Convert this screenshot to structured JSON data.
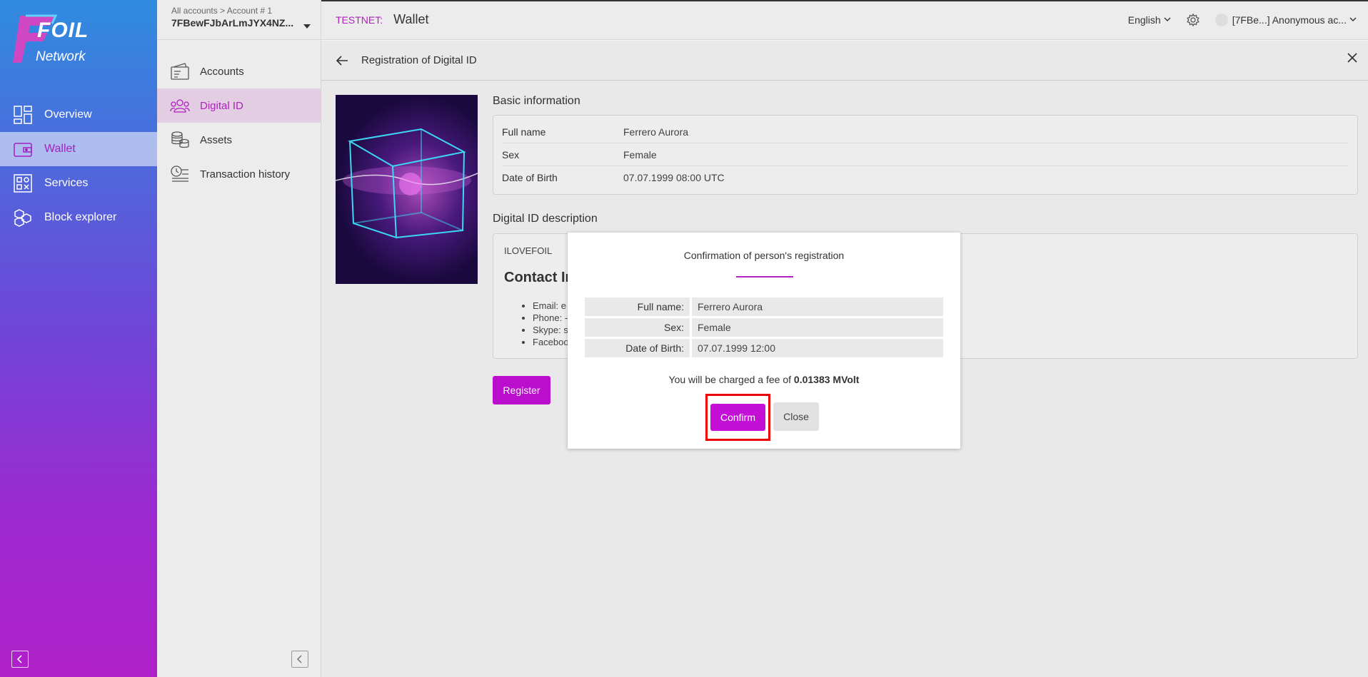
{
  "brand": {
    "name_line1": "FOIL",
    "name_line2": "Network"
  },
  "main_nav": [
    {
      "label": "Overview",
      "icon": "overview-icon",
      "active": false
    },
    {
      "label": "Wallet",
      "icon": "wallet-icon",
      "active": true
    },
    {
      "label": "Services",
      "icon": "services-icon",
      "active": false
    },
    {
      "label": "Block explorer",
      "icon": "block-explorer-icon",
      "active": false
    }
  ],
  "account": {
    "breadcrumb": "All accounts > Account # 1",
    "id": "7FBewFJbArLmJYX4NZ..."
  },
  "sub_nav": [
    {
      "label": "Accounts",
      "icon": "accounts-icon"
    },
    {
      "label": "Digital ID",
      "icon": "digital-id-icon"
    },
    {
      "label": "Assets",
      "icon": "assets-icon"
    },
    {
      "label": "Transaction history",
      "icon": "transaction-history-icon"
    }
  ],
  "topbar": {
    "network": "TESTNET:",
    "title": "Wallet",
    "language": "English",
    "user": "[7FBe...] Anonymous ac..."
  },
  "content": {
    "header_title": "Registration of Digital ID",
    "basic_info_title": "Basic information",
    "basic_info": [
      {
        "label": "Full name",
        "value": "Ferrero Aurora"
      },
      {
        "label": "Sex",
        "value": "Female"
      },
      {
        "label": "Date of Birth",
        "value": "07.07.1999 08:00 UTC"
      }
    ],
    "description_title": "Digital ID description",
    "description_text": "ILOVEFOIL",
    "description_heading": "Contact In",
    "description_list": [
      "Email: e",
      "Phone: -",
      "Skype: s",
      "Faceboo"
    ],
    "register_label": "Register"
  },
  "modal": {
    "title": "Confirmation of person's registration",
    "rows": [
      {
        "label": "Full name:",
        "value": "Ferrero Aurora"
      },
      {
        "label": "Sex:",
        "value": "Female"
      },
      {
        "label": "Date of Birth:",
        "value": "07.07.1999 12:00"
      }
    ],
    "fee_prefix": "You will be charged a fee of",
    "fee_amount": "0.01383 MVolt",
    "confirm_label": "Confirm",
    "close_label": "Close"
  },
  "colors": {
    "accent": "#c30fd6",
    "highlight": "#ee0000"
  }
}
